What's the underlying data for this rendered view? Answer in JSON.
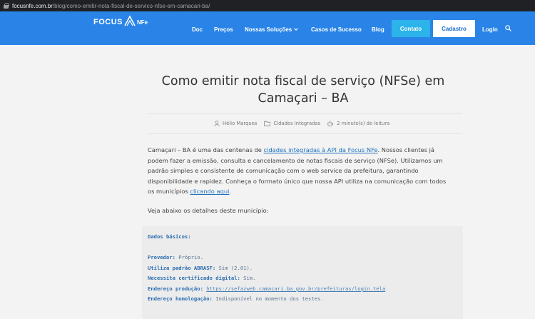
{
  "browser": {
    "url_host": "focusnfe.com.br",
    "url_path": "/blog/como-emitir-nota-fiscal-de-servico-nfse-em-camacari-ba/"
  },
  "header": {
    "logo_text": "FOCUS",
    "logo_suffix": "NFe",
    "nav": {
      "doc": "Doc",
      "precos": "Preços",
      "solucoes": "Nossas Soluções",
      "casos": "Casos de Sucesso",
      "blog": "Blog",
      "contato": "Contato",
      "cadastro": "Cadastro",
      "login": "Login"
    },
    "search_icon": "search-icon",
    "colors": {
      "bar": "#2a84e8",
      "contato": "#2bb3ea",
      "cadastro_text": "#1e6fd0"
    }
  },
  "post": {
    "title": "Como emitir nota fiscal de serviço (NFSe) em Camaçari – BA",
    "meta": {
      "author": "Hélio Marques",
      "category": "Cidades Integradas",
      "reading_time": "2 minuto(s) de leitura"
    },
    "intro": {
      "p1": "Camaçari – BA é uma das centenas de ",
      "link1": "cidades integradas à API da Focus NFe",
      "p2": ". Nossos clientes já podem fazer a emissão, consulta e cancelamento de notas fiscais de serviço (NFSe). Utilizamos um padrão simples e consistente de comunicação com o web service da prefeitura, garantindo disponibilidade e rapidez. Conheça o formato único que nossa API utiliza na comunicação com todos os municípios ",
      "link2": "clicando aqui",
      "p3": "."
    },
    "details_lead": "Veja abaixo os detalhes deste município:",
    "code": {
      "heading": "Dados básicos:",
      "rows": [
        {
          "key": "Provedor:",
          "value": " Próprio."
        },
        {
          "key": "Utiliza padrão ABRASF:",
          "value": " Sim (2.01)."
        },
        {
          "key": "Necessita certificado digital:",
          "value": " Sim."
        },
        {
          "key": "Endereço produção:",
          "value": "https://sefazweb.camacari.ba.gov.br/prefeituras/login.tela"
        },
        {
          "key": "Endereço homologação:",
          "value": " Indisponível no momento dos testes."
        }
      ]
    }
  }
}
